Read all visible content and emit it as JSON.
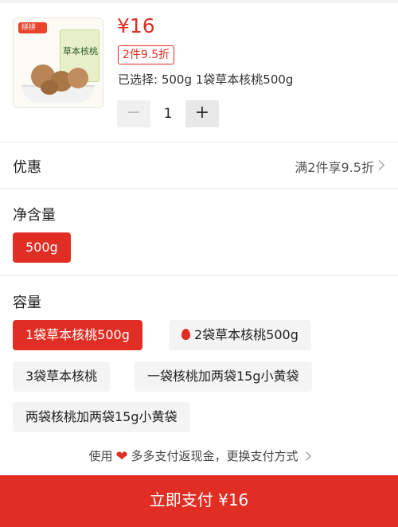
{
  "product": {
    "logo_text": "拼拼",
    "bag_title": "草本核桃",
    "price": "¥16",
    "promo_badge": "2件9.5折",
    "selected": "已选择: 500g 1袋草本核桃500g"
  },
  "quantity": {
    "minus": "−",
    "value": "1",
    "plus": "+"
  },
  "discount": {
    "label": "优惠",
    "value": "满2件享9.5折"
  },
  "net_content": {
    "label": "净含量",
    "options": [
      "500g"
    ],
    "selected": "500g"
  },
  "capacity": {
    "label": "容量",
    "options": [
      "1袋草本核桃500g",
      "2袋草本核桃500g",
      "3袋草本核桃",
      "一袋核桃加两袋15g小黄袋",
      "两袋核桃加两袋15g小黄袋"
    ],
    "selected": "1袋草本核桃500g",
    "hot_option_index": 1
  },
  "payment_hint": {
    "prefix": "使用",
    "text": "多多支付返现金，更换支付方式"
  },
  "pay_button": {
    "label": "立即支付 ¥16"
  },
  "colors": {
    "accent": "#e02e24",
    "chip_bg": "#f4f4f4"
  },
  "icons": {
    "minus": "minus-icon",
    "plus": "plus-icon",
    "fire": "fire-icon",
    "heart": "heart-icon",
    "chevron": "chevron-right-icon"
  }
}
